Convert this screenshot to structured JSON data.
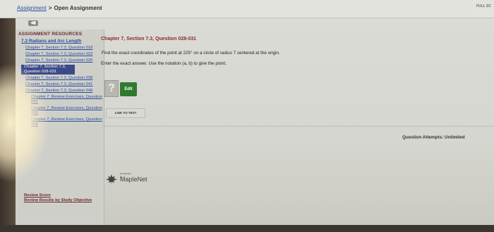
{
  "breadcrumb": {
    "link": "Assignment",
    "separator": ">",
    "current": "Open Assignment"
  },
  "top_right": "FULL SC",
  "sidebar": {
    "heading": "ASSIGNMENT RESOURCES",
    "section_title": "7.3 Radians and Arc Length",
    "items": [
      {
        "label": "Chapter 7, Section 7.3, Question 018"
      },
      {
        "label": "Chapter 7, Section 7.3, Question 023"
      },
      {
        "label": "Chapter 7, Section 7.3, Question 025"
      },
      {
        "label": "Chapter 7, Section 7.3, Question 028-031"
      },
      {
        "label": "Chapter 7, Section 7.3, Question 038"
      },
      {
        "label": "Chapter 7, Section 7.3, Question 041"
      },
      {
        "label": "Chapter 7, Section 7.3, Question 049"
      },
      {
        "label": "Chapter 7, Review Exercises, Question 081"
      },
      {
        "label": "Chapter 7, Review Exercises, Question 083"
      },
      {
        "label": "Chapter 7, Review Exercises, Question 084"
      }
    ],
    "bottom_links": [
      "Review Score",
      "Review Results by Study Objective"
    ]
  },
  "question": {
    "title": "Chapter 7, Section 7.3, Question 028-031",
    "text": "Find the exact coordinates of the point at 225° on a circle of radius 7 centered at the origin.",
    "instructions": "Enter the exact answer. Use the notation (a, b) to give the point.",
    "placeholder_symbol": "?",
    "edit_label": "Edit",
    "link_to_text": "LINK TO TEXT",
    "attempts": "Question Attempts: Unlimited"
  },
  "brand": {
    "powered_by": "powered by",
    "name": "MapleNet"
  },
  "colors": {
    "link": "#2a4f9a",
    "title": "#8a2a2a",
    "edit": "#2f7a2f",
    "current": "#3d4a88"
  }
}
